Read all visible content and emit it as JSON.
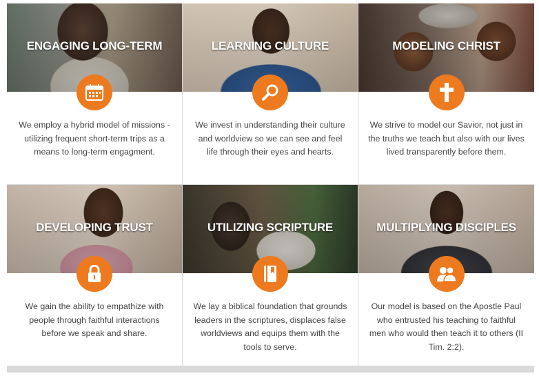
{
  "accent_color": "#ee7a1f",
  "cards": [
    {
      "title": "ENGAGING LONG-TERM",
      "icon": "calendar-icon",
      "description": "We employ a hybrid model of missions - utilizing frequent short-term trips as a means to long-term engagment."
    },
    {
      "title": "LEARNING CULTURE",
      "icon": "magnifier-icon",
      "description": "We invest in understanding their culture and worldview so we can see and feel life through their eyes and hearts."
    },
    {
      "title": "MODELING CHRIST",
      "icon": "cross-icon",
      "description": "We strive to model our Savior, not just in the truths we teach but also with our lives lived transparently before them."
    },
    {
      "title": "DEVELOPING TRUST",
      "icon": "lock-icon",
      "description": "We gain the ability to empathize with people through faithful interactions before we speak and share."
    },
    {
      "title": "UTILIZING SCRIPTURE",
      "icon": "book-icon",
      "description": "We lay a biblical foundation that grounds leaders in the scriptures, displaces false worldviews and equips them with the tools to serve."
    },
    {
      "title": "MULTIPLYING DISCIPLES",
      "icon": "people-icon",
      "description": "Our model is based on the Apostle Paul who entrusted his teaching to faithful men who would then teach it to others (II Tim. 2:2)."
    }
  ]
}
